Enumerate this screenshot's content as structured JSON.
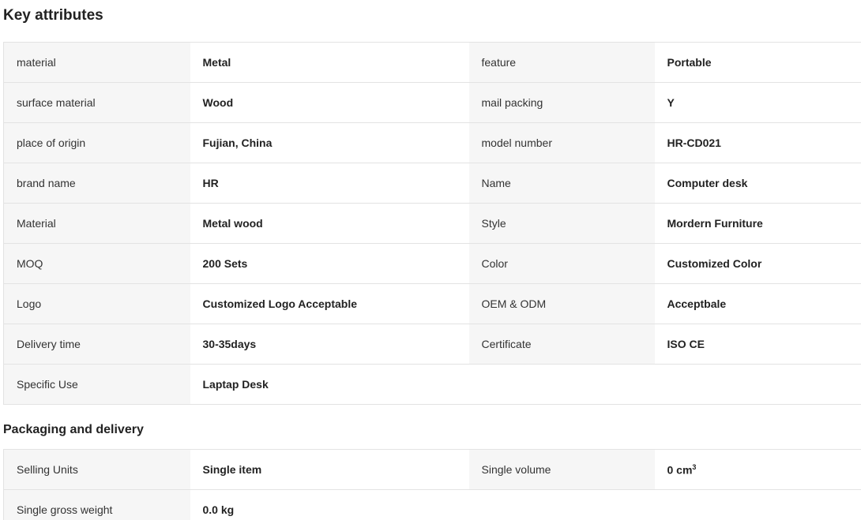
{
  "key_attributes": {
    "title": "Key attributes",
    "rows": [
      {
        "l1": "material",
        "v1": "Metal",
        "l2": "feature",
        "v2": "Portable"
      },
      {
        "l1": "surface material",
        "v1": "Wood",
        "l2": "mail packing",
        "v2": "Y"
      },
      {
        "l1": "place of origin",
        "v1": "Fujian, China",
        "l2": "model number",
        "v2": "HR-CD021"
      },
      {
        "l1": "brand name",
        "v1": "HR",
        "l2": "Name",
        "v2": "Computer desk"
      },
      {
        "l1": "Material",
        "v1": "Metal wood",
        "l2": "Style",
        "v2": "Mordern Furniture"
      },
      {
        "l1": "MOQ",
        "v1": "200 Sets",
        "l2": "Color",
        "v2": "Customized Color"
      },
      {
        "l1": "Logo",
        "v1": "Customized Logo Acceptable",
        "l2": "OEM & ODM",
        "v2": "Acceptbale"
      },
      {
        "l1": "Delivery time",
        "v1": "30-35days",
        "l2": "Certificate",
        "v2": "ISO CE"
      },
      {
        "l1": "Specific Use",
        "v1": "Laptap Desk"
      }
    ]
  },
  "packaging": {
    "title": "Packaging and delivery",
    "rows": [
      {
        "l1": "Selling Units",
        "v1": "Single item",
        "l2": "Single volume",
        "v2": "0 cm",
        "v2_sup": "3"
      },
      {
        "l1": "Single gross weight",
        "v1": "0.0 kg"
      }
    ]
  }
}
